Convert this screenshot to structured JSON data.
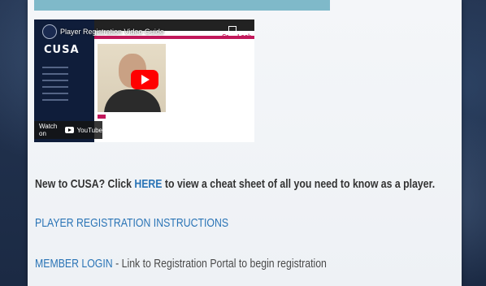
{
  "video": {
    "title": "Player Registration Video Guide",
    "logo": "CUSA",
    "overlay_text": "Crew Look",
    "watch_label": "Watch on",
    "youtube_label": "YouTube"
  },
  "content": {
    "line1_prefix": "New to CUSA? Click ",
    "line1_link": "HERE",
    "line1_suffix": " to view a cheat sheet of all you need to know as a player.",
    "instructions_link": "PLAYER REGISTRATION INSTRUCTIONS",
    "member_login_link": "MEMBER LOGIN",
    "member_login_desc": " - Link to Registration Portal to begin registration"
  },
  "colors": {
    "link": "#2a74b6",
    "accent_pink": "#c2185b",
    "teal_bar": "#7fb9c9"
  },
  "icons": {
    "play": "play-icon",
    "copy": "copy-icon",
    "youtube": "youtube-icon",
    "avatar": "channel-avatar-icon"
  }
}
